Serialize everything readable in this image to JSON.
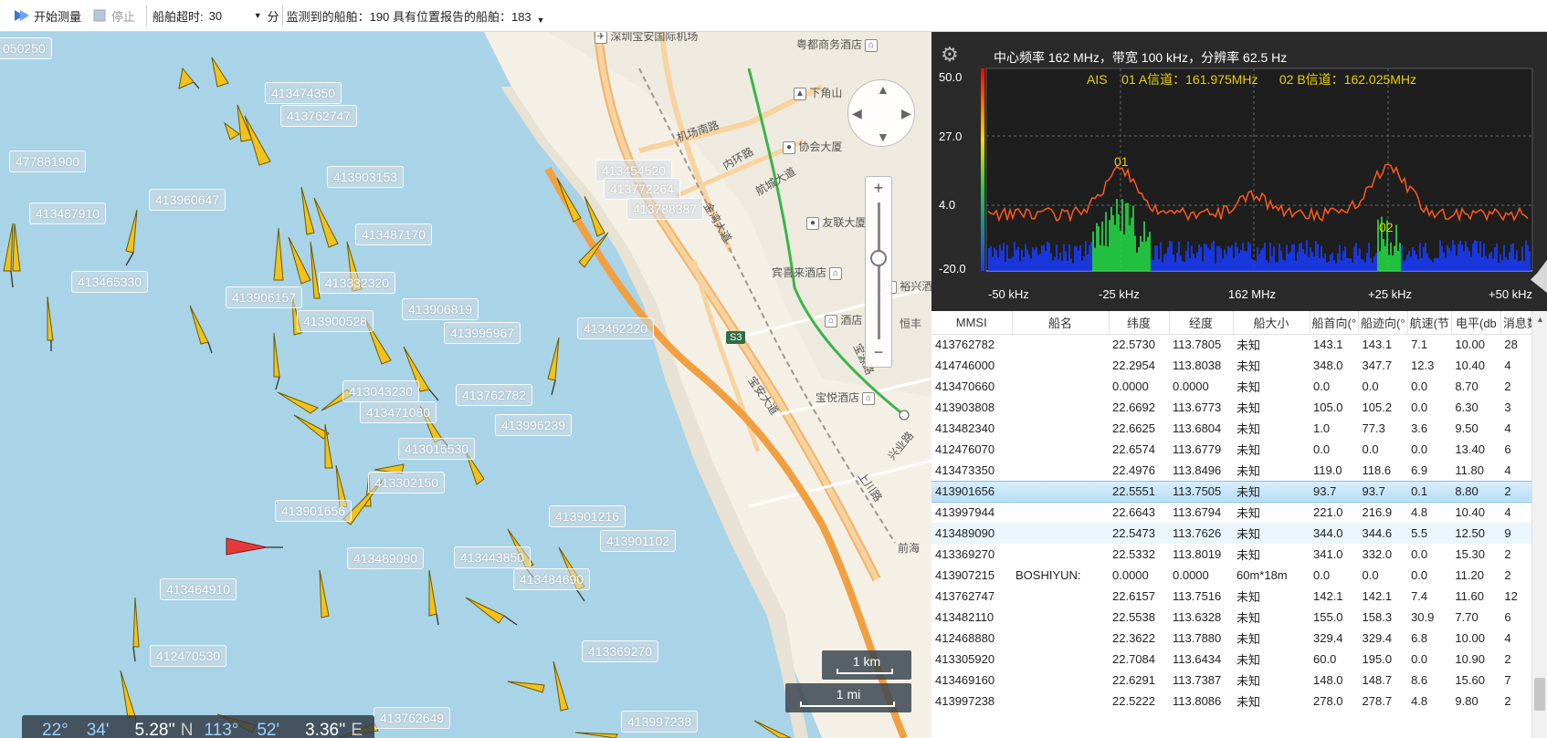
{
  "toolbar": {
    "start_label": "开始测量",
    "stop_label": "停止",
    "timeout_label": "船舶超时:",
    "timeout_value": "30",
    "timeout_unit": "分",
    "status": "监测到的船舶：190 具有位置报告的船舶：183",
    "start_icon": "play-icon",
    "stop_icon": "stop-icon"
  },
  "map": {
    "ship_labels": [
      "050250",
      "413474350",
      "413762747",
      "477881900",
      "413903153",
      "413454520",
      "413772264",
      "413788387",
      "413960647",
      "413487910",
      "413487170",
      "413465330",
      "413906157",
      "413332320",
      "413906819",
      "413900528",
      "413995967",
      "413462220",
      "413043230",
      "413762782",
      "413471080",
      "413996239",
      "413016530",
      "413302150",
      "413901656",
      "413901216",
      "413901102",
      "413489090",
      "413443850",
      "413484690",
      "413464910",
      "412470530",
      "413369270",
      "413762649",
      "413997238"
    ],
    "pois": [
      "深圳宝安国际机场",
      "粤都商务酒店",
      "下角山",
      "协会大厦",
      "友联大厦",
      "宾喜来酒店",
      "裕兴酒",
      "酒店",
      "宝悦酒店",
      "恒丰",
      "前海"
    ],
    "roads": [
      "机场南路",
      "内环路",
      "航城大道",
      "金湾大道",
      "宝安大道",
      "宝源路",
      "上川路",
      "兴业路"
    ],
    "highway_badge": "S3",
    "coords": {
      "lat_deg": "22°",
      "lat_min": "34'",
      "lat_sec": "5.28''",
      "lat_hemi": "N",
      "lon_deg": "113°",
      "lon_min": "52'",
      "lon_sec": "3.36''",
      "lon_hemi": "E"
    },
    "scale_km": "1 km",
    "scale_mi": "1 mi"
  },
  "spectrum": {
    "title": "中心频率 162 MHz，带宽 100 kHz，分辨率 62.5 Hz",
    "channel_info": "AIS    01 A信道：161.975MHz      02 B信道：162.025MHz",
    "marker_01": "01",
    "marker_02": "02",
    "y_ticks": [
      "50.0",
      "27.0",
      "4.0",
      "-20.0"
    ],
    "x_ticks": [
      "-50 kHz",
      "-25 kHz",
      "162 MHz",
      "+25 kHz",
      "+50 kHz"
    ],
    "colors": {
      "trace": "#ff5a1a",
      "waterfall_low": "#1a3cff",
      "waterfall_high": "#22dd44",
      "label": "#e8d000"
    }
  },
  "table": {
    "columns": [
      "MMSI",
      "船名",
      "纬度",
      "经度",
      "船大小",
      "船首向(°",
      "船迹向(°",
      "航速(节",
      "电平(db",
      "消息数"
    ],
    "rows": [
      [
        "413762782",
        "",
        "22.5730",
        "113.7805",
        "未知",
        "143.1",
        "143.1",
        "7.1",
        "10.00",
        "28"
      ],
      [
        "414746000",
        "",
        "22.2954",
        "113.8038",
        "未知",
        "348.0",
        "347.7",
        "12.3",
        "10.40",
        "4"
      ],
      [
        "413470660",
        "",
        "0.0000",
        "0.0000",
        "未知",
        "0.0",
        "0.0",
        "0.0",
        "8.70",
        "2"
      ],
      [
        "413903808",
        "",
        "22.6692",
        "113.6773",
        "未知",
        "105.0",
        "105.2",
        "0.0",
        "6.30",
        "3"
      ],
      [
        "413482340",
        "",
        "22.6625",
        "113.6804",
        "未知",
        "1.0",
        "77.3",
        "3.6",
        "9.50",
        "4"
      ],
      [
        "412476070",
        "",
        "22.6574",
        "113.6779",
        "未知",
        "0.0",
        "0.0",
        "0.0",
        "13.40",
        "6"
      ],
      [
        "413473350",
        "",
        "22.4976",
        "113.8496",
        "未知",
        "119.0",
        "118.6",
        "6.9",
        "11.80",
        "4"
      ],
      [
        "413901656",
        "",
        "22.5551",
        "113.7505",
        "未知",
        "93.7",
        "93.7",
        "0.1",
        "8.80",
        "2"
      ],
      [
        "413997944",
        "",
        "22.6643",
        "113.6794",
        "未知",
        "221.0",
        "216.9",
        "4.8",
        "10.40",
        "4"
      ],
      [
        "413489090",
        "",
        "22.5473",
        "113.7626",
        "未知",
        "344.0",
        "344.6",
        "5.5",
        "12.50",
        "9"
      ],
      [
        "413369270",
        "",
        "22.5332",
        "113.8019",
        "未知",
        "341.0",
        "332.0",
        "0.0",
        "15.30",
        "2"
      ],
      [
        "413907215",
        "BOSHIYUN:",
        "0.0000",
        "0.0000",
        "60m*18m",
        "0.0",
        "0.0",
        "0.0",
        "11.20",
        "2"
      ],
      [
        "413762747",
        "",
        "22.6157",
        "113.7516",
        "未知",
        "142.1",
        "142.1",
        "7.4",
        "11.60",
        "12"
      ],
      [
        "413482110",
        "",
        "22.5538",
        "113.6328",
        "未知",
        "155.0",
        "158.3",
        "30.9",
        "7.70",
        "6"
      ],
      [
        "412468880",
        "",
        "22.3622",
        "113.7880",
        "未知",
        "329.4",
        "329.4",
        "6.8",
        "10.00",
        "4"
      ],
      [
        "413305920",
        "",
        "22.7084",
        "113.6434",
        "未知",
        "60.0",
        "195.0",
        "0.0",
        "10.90",
        "2"
      ],
      [
        "413469160",
        "",
        "22.6291",
        "113.7387",
        "未知",
        "148.0",
        "148.7",
        "8.6",
        "15.60",
        "7"
      ],
      [
        "413997238",
        "",
        "22.5222",
        "113.8086",
        "未知",
        "278.0",
        "278.7",
        "4.8",
        "9.80",
        "2"
      ]
    ],
    "selected_row": 7,
    "hover_row": 9
  }
}
